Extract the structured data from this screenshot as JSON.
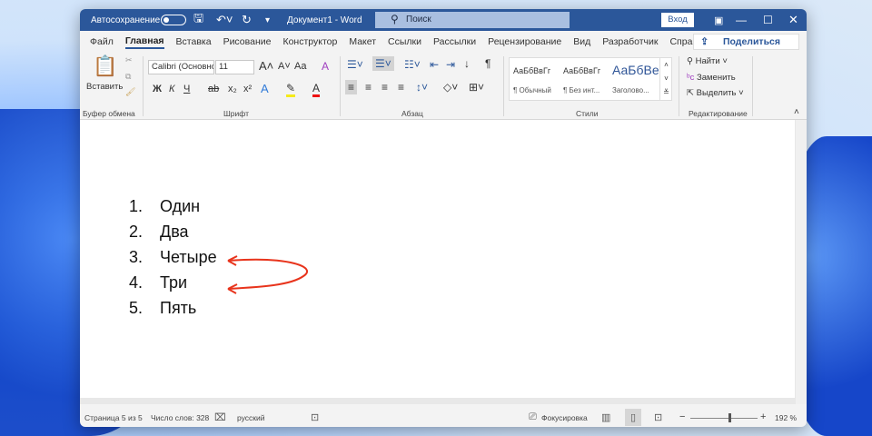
{
  "titlebar": {
    "autosave": "Автосохранение",
    "doc_title": "Документ1  -  Word",
    "search_placeholder": "Поиск",
    "login": "Вход"
  },
  "tabs": [
    "Файл",
    "Главная",
    "Вставка",
    "Рисование",
    "Конструктор",
    "Макет",
    "Ссылки",
    "Рассылки",
    "Рецензирование",
    "Вид",
    "Разработчик",
    "Справка"
  ],
  "share": "Поделиться",
  "ribbon": {
    "clipboard": {
      "paste": "Вставить",
      "group": "Буфер обмена"
    },
    "font": {
      "name": "Calibri (Основной)",
      "size": "11",
      "group": "Шрифт",
      "bold": "Ж",
      "italic": "К",
      "underline": "Ч",
      "case": "Aa"
    },
    "paragraph": {
      "group": "Абзац"
    },
    "styles": {
      "group": "Стили",
      "items": [
        {
          "preview": "АаБбВвГг",
          "label": "¶ Обычный"
        },
        {
          "preview": "АаБбВвГг",
          "label": "¶ Без инт..."
        },
        {
          "preview": "АаБбВе",
          "label": "Заголово..."
        }
      ]
    },
    "editing": {
      "group": "Редактирование",
      "find": "Найти",
      "replace": "Заменить",
      "select": "Выделить"
    }
  },
  "document": {
    "list": [
      {
        "n": "1.",
        "text": "Один"
      },
      {
        "n": "2.",
        "text": "Два"
      },
      {
        "n": "3.",
        "text": "Четыре"
      },
      {
        "n": "4.",
        "text": "Три"
      },
      {
        "n": "5.",
        "text": "Пять"
      }
    ],
    "annotation_color": "#e8341c"
  },
  "status": {
    "page": "Страница 5 из 5",
    "words": "Число слов: 328",
    "lang": "русский",
    "focus": "Фокусировка",
    "zoom": "192 %"
  },
  "colors": {
    "accent": "#2b579a"
  }
}
